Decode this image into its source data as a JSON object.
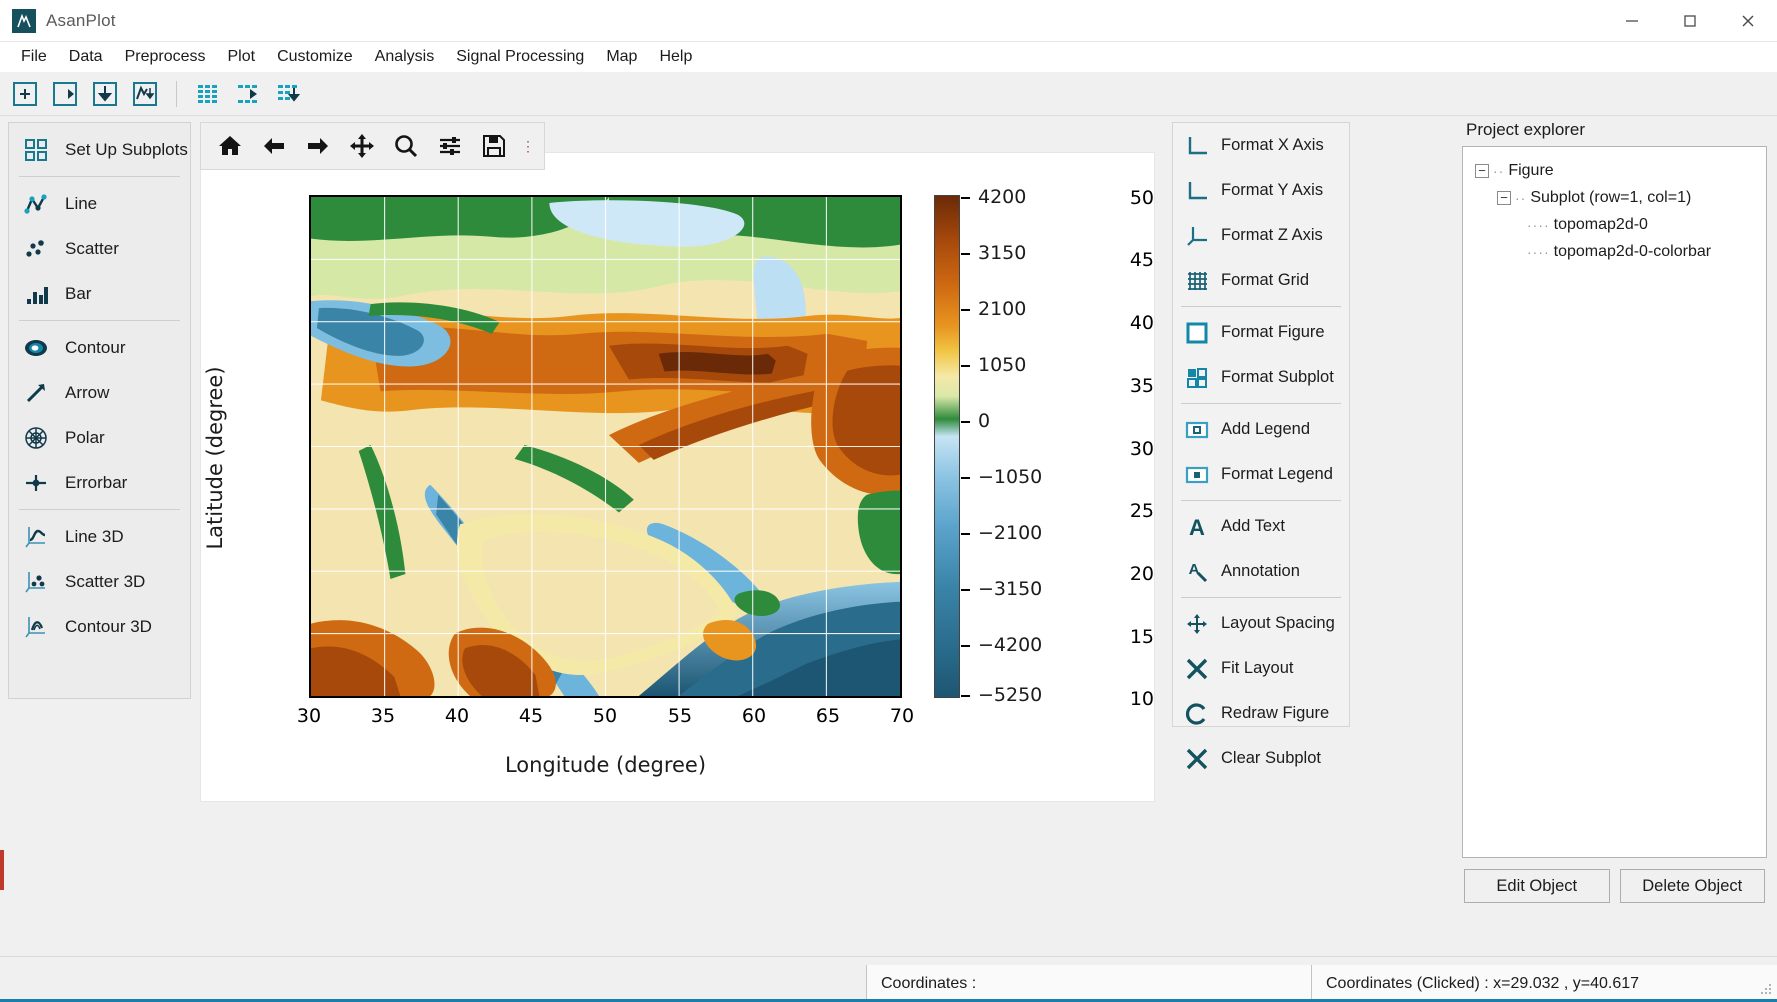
{
  "window": {
    "title": "AsanPlot",
    "logo_icon": "asanplot-logo-icon",
    "minimize_icon": "minimize-icon",
    "maximize_icon": "maximize-icon",
    "close_icon": "close-icon"
  },
  "menubar": {
    "items": [
      {
        "label": "File"
      },
      {
        "label": "Data"
      },
      {
        "label": "Preprocess"
      },
      {
        "label": "Plot"
      },
      {
        "label": "Customize"
      },
      {
        "label": "Analysis"
      },
      {
        "label": "Signal Processing"
      },
      {
        "label": "Map"
      },
      {
        "label": "Help"
      }
    ]
  },
  "main_toolbar": {
    "buttons": [
      {
        "icon": "new-figure-icon"
      },
      {
        "icon": "open-figure-icon"
      },
      {
        "icon": "save-figure-icon"
      },
      {
        "icon": "export-plot-icon"
      },
      {
        "icon": "table-icon"
      },
      {
        "icon": "import-table-icon"
      },
      {
        "icon": "export-table-icon"
      }
    ]
  },
  "sidebar": {
    "groups": [
      {
        "items": [
          {
            "label": "Set Up Subplots",
            "icon": "subplots-icon"
          }
        ]
      },
      {
        "items": [
          {
            "label": "Line",
            "icon": "line-icon"
          },
          {
            "label": "Scatter",
            "icon": "scatter-icon"
          },
          {
            "label": "Bar",
            "icon": "bar-icon"
          }
        ]
      },
      {
        "items": [
          {
            "label": "Contour",
            "icon": "contour-icon"
          },
          {
            "label": "Arrow",
            "icon": "arrow-icon"
          },
          {
            "label": "Polar",
            "icon": "polar-icon"
          },
          {
            "label": "Errorbar",
            "icon": "errorbar-icon"
          }
        ]
      },
      {
        "items": [
          {
            "label": "Line 3D",
            "icon": "line3d-icon"
          },
          {
            "label": "Scatter 3D",
            "icon": "scatter3d-icon"
          },
          {
            "label": "Contour 3D",
            "icon": "contour3d-icon"
          }
        ]
      }
    ]
  },
  "plot_toolbar": {
    "buttons": [
      {
        "icon": "home-icon"
      },
      {
        "icon": "back-arrow-icon"
      },
      {
        "icon": "forward-arrow-icon"
      },
      {
        "icon": "pan-icon"
      },
      {
        "icon": "zoom-icon"
      },
      {
        "icon": "configure-subplots-icon"
      },
      {
        "icon": "save-icon"
      }
    ],
    "overflow": "⋮"
  },
  "format_panel": {
    "groups": [
      {
        "items": [
          {
            "label": "Format X Axis",
            "icon": "x-axis-icon"
          },
          {
            "label": "Format Y Axis",
            "icon": "y-axis-icon"
          },
          {
            "label": "Format Z Axis",
            "icon": "z-axis-icon"
          },
          {
            "label": "Format Grid",
            "icon": "grid-icon"
          }
        ]
      },
      {
        "items": [
          {
            "label": "Format Figure",
            "icon": "figure-icon"
          },
          {
            "label": "Format Subplot",
            "icon": "subplot-icon"
          }
        ]
      },
      {
        "items": [
          {
            "label": "Add Legend",
            "icon": "add-legend-icon"
          },
          {
            "label": "Format Legend",
            "icon": "format-legend-icon"
          }
        ]
      },
      {
        "items": [
          {
            "label": "Add Text",
            "icon": "add-text-icon"
          },
          {
            "label": "Annotation",
            "icon": "annotation-icon"
          }
        ]
      },
      {
        "items": [
          {
            "label": "Layout Spacing",
            "icon": "layout-spacing-icon"
          },
          {
            "label": "Fit Layout",
            "icon": "fit-layout-icon"
          },
          {
            "label": "Redraw Figure",
            "icon": "redraw-icon"
          },
          {
            "label": "Clear Subplot",
            "icon": "clear-subplot-icon"
          }
        ]
      }
    ]
  },
  "explorer": {
    "title": "Project explorer",
    "tree": [
      {
        "label": "Figure",
        "depth": 0,
        "toggle": "−"
      },
      {
        "label": "Subplot (row=1, col=1)",
        "depth": 1,
        "toggle": "−"
      },
      {
        "label": "topomap2d-0",
        "depth": 2,
        "toggle": ""
      },
      {
        "label": "topomap2d-0-colorbar",
        "depth": 2,
        "toggle": ""
      }
    ],
    "buttons": [
      {
        "label": "Edit Object"
      },
      {
        "label": "Delete Object"
      }
    ]
  },
  "statusbar": {
    "coordinates_label": "Coordinates :",
    "clicked_label": "Coordinates (Clicked) : x=29.032 , y=40.617",
    "accent_color": "#1a7fa8"
  },
  "chart_data": {
    "type": "heatmap",
    "title": "",
    "xlabel": "Longitude (degree)",
    "ylabel": "Latitude (degree)",
    "xlim": [
      30,
      70
    ],
    "ylim": [
      10,
      50
    ],
    "xticks": [
      30,
      35,
      40,
      45,
      50,
      55,
      60,
      65,
      70
    ],
    "yticks": [
      10,
      15,
      20,
      25,
      30,
      35,
      40,
      45,
      50
    ],
    "grid": true,
    "grid_color": "#ffffff",
    "colorbar": {
      "label": "",
      "ticks": [
        4200,
        3150,
        2100,
        1050,
        0,
        -1050,
        -2100,
        -3150,
        -4200,
        -5250
      ],
      "tick_labels": [
        "4200",
        "3150",
        "2100",
        "1050",
        "0",
        "−1050",
        "−2100",
        "−3150",
        "−4200",
        "−5250"
      ],
      "vmin": -5250,
      "vmax": 4200,
      "position": "right",
      "colors": [
        {
          "stop": 0.0,
          "hex": "#1d5673"
        },
        {
          "stop": 0.1,
          "hex": "#2a6c8c"
        },
        {
          "stop": 0.22,
          "hex": "#3a84a8"
        },
        {
          "stop": 0.34,
          "hex": "#5ba3cc"
        },
        {
          "stop": 0.44,
          "hex": "#8cc4e3"
        },
        {
          "stop": 0.52,
          "hex": "#c6e4f4"
        },
        {
          "stop": 0.555,
          "hex": "#2e8b3c"
        },
        {
          "stop": 0.6,
          "hex": "#d9e8a8"
        },
        {
          "stop": 0.64,
          "hex": "#f5e9a8"
        },
        {
          "stop": 0.69,
          "hex": "#f1c544"
        },
        {
          "stop": 0.74,
          "hex": "#e89520"
        },
        {
          "stop": 0.82,
          "hex": "#cf6a12"
        },
        {
          "stop": 0.91,
          "hex": "#a8490c"
        },
        {
          "stop": 1.0,
          "hex": "#6b2a07"
        }
      ]
    },
    "description": "Topographic elevation map of the Middle East region; elevation in metres from -5250 to 4200.",
    "z_range_m": [
      -5250,
      4200
    ]
  }
}
